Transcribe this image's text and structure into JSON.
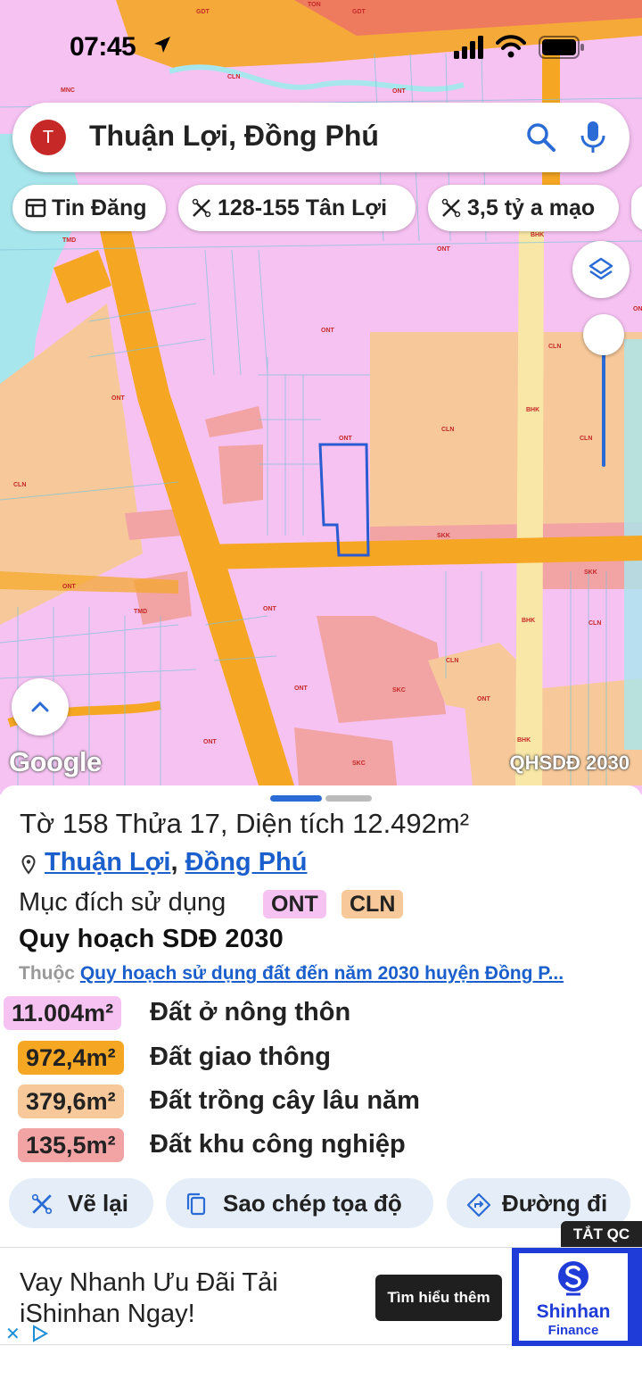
{
  "status_bar": {
    "time": "07:45"
  },
  "search": {
    "avatar_letter": "T",
    "query": "Thuận Lợi, Đồng Phú"
  },
  "chips": [
    {
      "label": "Tin Đăng",
      "icon": "listing-icon"
    },
    {
      "label": "128-155 Tân Lợi",
      "icon": "ruler-icon"
    },
    {
      "label": "3,5 tỷ a mạo",
      "icon": "ruler-icon"
    }
  ],
  "map": {
    "google_label": "Google",
    "layer_label": "QHSDĐ 2030",
    "zone_labels": [
      "ONT",
      "CLN",
      "BHK",
      "SKK",
      "TMD",
      "SKC",
      "MNC",
      "GDT",
      "TON"
    ],
    "colors": {
      "residential": "#f6c2f2",
      "road": "#f5a623",
      "perennial": "#f7c99a",
      "industrial": "#f2a3a3",
      "water": "#a8e6ee",
      "highway_strip": "#f8e7a6",
      "parcel_outline": "#2a5bd0"
    }
  },
  "parcel": {
    "title": "Tờ 158 Thửa 17, Diện tích 12.492m²",
    "commune": "Thuận Lợi",
    "separator": ",",
    "district": "Đồng Phú",
    "purpose_label": "Mục đích sử dụng",
    "purpose_tags": [
      {
        "code": "ONT",
        "color": "#f6c2f2"
      },
      {
        "code": "CLN",
        "color": "#f7c99a"
      }
    ],
    "plan_title": "Quy hoạch SDĐ 2030",
    "belong_prefix": "Thuộc",
    "belong_link": "Quy hoạch sử dụng đất đến năm 2030 huyện Đồng P...",
    "areas": [
      {
        "value": "11.004m²",
        "name": "Đất ở nông thôn",
        "color": "#f6c2f2"
      },
      {
        "value": "972,4m²",
        "name": "Đất giao thông",
        "color": "#f5a623"
      },
      {
        "value": "379,6m²",
        "name": "Đất trồng cây lâu năm",
        "color": "#f7c99a"
      },
      {
        "value": "135,5m²",
        "name": "Đất khu công nghiệp",
        "color": "#f2a3a3"
      }
    ]
  },
  "actions": [
    {
      "label": "Vẽ lại",
      "icon": "redraw-icon"
    },
    {
      "label": "Sao chép tọa độ",
      "icon": "copy-icon"
    },
    {
      "label": "Đường đi",
      "icon": "directions-icon"
    }
  ],
  "ad": {
    "close_label": "TẮT QC",
    "headline": "Vay Nhanh Ưu Đãi Tải iShinhan Ngay!",
    "cta": "Tìm hiểu thêm",
    "brand_name": "Shinhan",
    "brand_sub": "Finance"
  }
}
